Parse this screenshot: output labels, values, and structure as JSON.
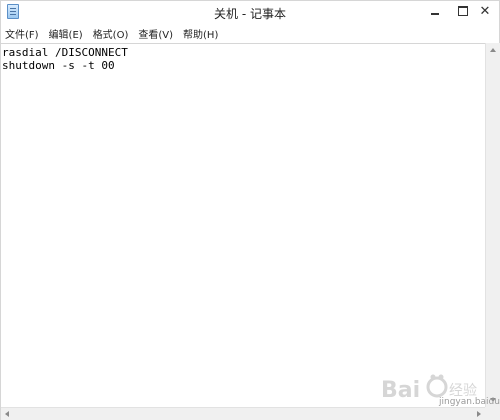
{
  "window": {
    "title": "关机 - 记事本"
  },
  "titlebar": {
    "icons": {
      "app": "notepad-icon",
      "minimize": "minimize-icon",
      "maximize": "maximize-icon",
      "close": "close-icon"
    },
    "close_glyph": "✕"
  },
  "menu": {
    "items": [
      {
        "label": "文件(F)"
      },
      {
        "label": "编辑(E)"
      },
      {
        "label": "格式(O)"
      },
      {
        "label": "查看(V)"
      },
      {
        "label": "帮助(H)"
      }
    ]
  },
  "editor": {
    "lines": [
      "rasdial /DISCONNECT",
      "shutdown -s -t 00"
    ]
  },
  "watermark": {
    "text": "jingyan.baidu.com"
  },
  "colors": {
    "background": "#ffffff",
    "border": "#d6d6d6",
    "scrollbar": "#f0f0f0"
  }
}
